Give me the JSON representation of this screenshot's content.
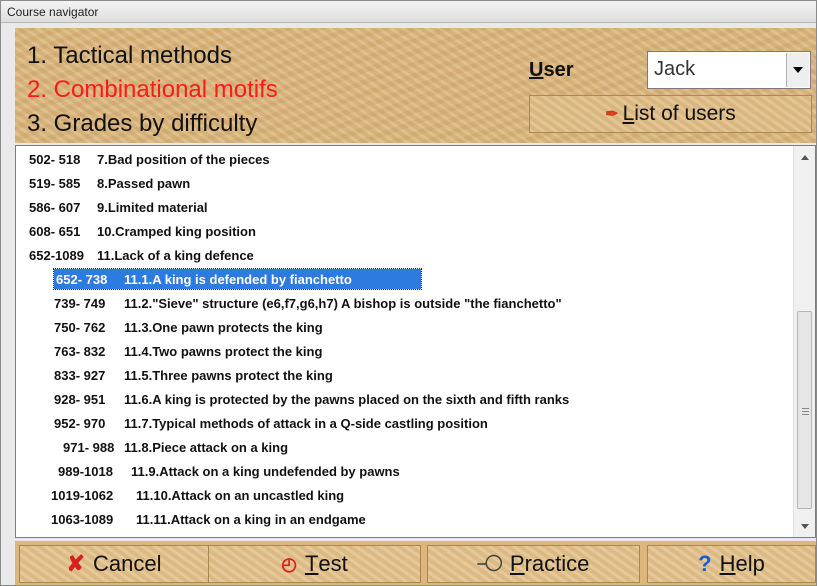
{
  "window": {
    "title": "Course navigator"
  },
  "menu": [
    {
      "label": "1. Tactical methods",
      "color": "#111111"
    },
    {
      "label": "2. Combinational motifs",
      "color": "#ff1a1a"
    },
    {
      "label": "3. Grades by difficulty",
      "color": "#111111"
    }
  ],
  "user": {
    "label_prefix": "U",
    "label_rest": "ser",
    "value": "Jack",
    "list_prefix": "L",
    "list_rest": "ist of users"
  },
  "list": {
    "rows": [
      {
        "range": "502- 518",
        "title": "7.Bad position of the pieces"
      },
      {
        "range": "519- 585",
        "title": "8.Passed pawn"
      },
      {
        "range": "586- 607",
        "title": "9.Limited material"
      },
      {
        "range": "608- 651",
        "title": "10.Cramped king position"
      },
      {
        "range": "652-1089",
        "title": "11.Lack of a king defence"
      },
      {
        "range": "652- 738",
        "title": "11.1.A king is defended by fianchetto"
      },
      {
        "range": "739- 749",
        "title": "11.2.\"Sieve\" structure (e6,f7,g6,h7) A bishop is outside \"the fianchetto\""
      },
      {
        "range": "750- 762",
        "title": "11.3.One pawn protects the king"
      },
      {
        "range": "763- 832",
        "title": "11.4.Two pawns protect the king"
      },
      {
        "range": "833- 927",
        "title": "11.5.Three pawns protect the king"
      },
      {
        "range": "928- 951",
        "title": "11.6.A king is protected by the pawns placed on the sixth and fifth ranks"
      },
      {
        "range": "952- 970",
        "title": "11.7.Typical methods of attack in a Q-side castling position"
      },
      {
        "range": "971- 988",
        "title": "11.8.Piece attack on a king"
      },
      {
        "range": "989-1018",
        "title": "11.9.Attack on a king undefended by pawns"
      },
      {
        "range": "1019-1062",
        "title": "11.10.Attack on an uncastled king"
      },
      {
        "range": "1063-1089",
        "title": "11.11.Attack on a king in an endgame"
      }
    ],
    "selected_index": 5
  },
  "buttons": {
    "cancel": "Cancel",
    "test_prefix": "T",
    "test_rest": "est",
    "practice_prefix": "P",
    "practice_rest": "ractice",
    "help_prefix": "H",
    "help_rest": "elp"
  },
  "icons": {
    "cancel": "x-icon",
    "test": "clock-icon",
    "practice": "key-icon",
    "help": "question-icon",
    "list_users": "users-icon"
  }
}
